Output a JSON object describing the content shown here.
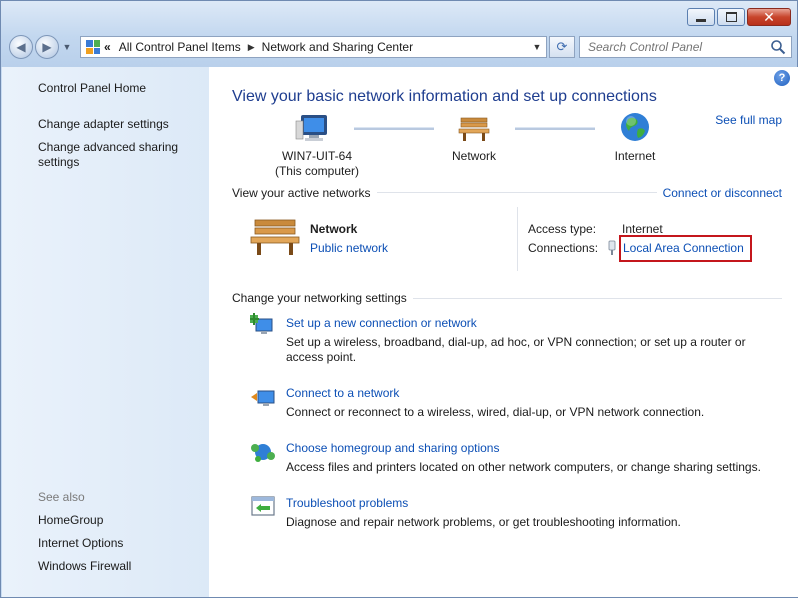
{
  "window": {
    "caption": {
      "minimize": "minimize",
      "maximize": "maximize",
      "close": "close"
    }
  },
  "nav": {
    "back_icon": "back-arrow-icon",
    "forward_icon": "forward-arrow-icon",
    "overflow": "«",
    "breadcrumb": [
      "All Control Panel Items",
      "Network and Sharing Center"
    ],
    "search_placeholder": "Search Control Panel"
  },
  "sidebar": {
    "home": "Control Panel Home",
    "links": [
      "Change adapter settings",
      "Change advanced sharing settings"
    ],
    "see_also_heading": "See also",
    "see_also": [
      "HomeGroup",
      "Internet Options",
      "Windows Firewall"
    ]
  },
  "main": {
    "title": "View your basic network information and set up connections",
    "see_full_map": "See full map",
    "map": {
      "computer_name": "WIN7-UIT-64",
      "computer_sub": "(This computer)",
      "network": "Network",
      "internet": "Internet"
    },
    "active_networks": {
      "heading": "View your active networks",
      "connect_link": "Connect or disconnect",
      "network_name": "Network",
      "network_type": "Public network",
      "access_type_label": "Access type:",
      "access_type_value": "Internet",
      "connections_label": "Connections:",
      "connection_value": "Local Area Connection"
    },
    "settings": {
      "heading": "Change your networking settings",
      "tasks": [
        {
          "title": "Set up a new connection or network",
          "desc": "Set up a wireless, broadband, dial-up, ad hoc, or VPN connection; or set up a router or access point."
        },
        {
          "title": "Connect to a network",
          "desc": "Connect or reconnect to a wireless, wired, dial-up, or VPN network connection."
        },
        {
          "title": "Choose homegroup and sharing options",
          "desc": "Access files and printers located on other network computers, or change sharing settings."
        },
        {
          "title": "Troubleshoot problems",
          "desc": "Diagnose and repair network problems, or get troubleshooting information."
        }
      ]
    }
  },
  "colors": {
    "link": "#0c4fb5",
    "title": "#1e3d8f",
    "highlight": "#c4161c",
    "sidebar": "#dce9f7"
  }
}
